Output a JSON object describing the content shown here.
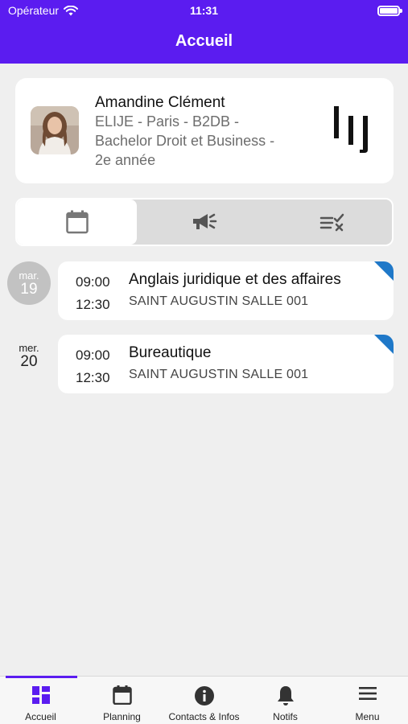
{
  "status_bar": {
    "carrier": "Opérateur",
    "time": "11:31"
  },
  "nav": {
    "title": "Accueil"
  },
  "profile": {
    "name": "Amandine Clément",
    "line1": "ELIJE - Paris - B2DB -",
    "line2": "Bachelor Droit et Business -",
    "line3": "2e année"
  },
  "segments": [
    {
      "icon": "calendar-icon",
      "active": true
    },
    {
      "icon": "megaphone-icon",
      "active": false
    },
    {
      "icon": "checklist-icon",
      "active": false
    }
  ],
  "days": [
    {
      "weekday": "mar.",
      "day": "19",
      "highlighted": true,
      "event": {
        "start": "09:00",
        "end": "12:30",
        "title": "Anglais juridique et des affaires",
        "room": "SAINT AUGUSTIN SALLE 001"
      }
    },
    {
      "weekday": "mer.",
      "day": "20",
      "highlighted": false,
      "event": {
        "start": "09:00",
        "end": "12:30",
        "title": "Bureautique",
        "room": "SAINT AUGUSTIN SALLE 001"
      }
    }
  ],
  "tabbar": {
    "items": [
      {
        "label": "Accueil",
        "icon": "dashboard-icon",
        "active": true
      },
      {
        "label": "Planning",
        "icon": "calendar-icon",
        "active": false
      },
      {
        "label": "Contacts & Infos",
        "icon": "info-icon",
        "active": false
      },
      {
        "label": "Notifs",
        "icon": "bell-icon",
        "active": false
      },
      {
        "label": "Menu",
        "icon": "hamburger-menu-icon",
        "active": false
      }
    ]
  },
  "colors": {
    "accent": "#5b1cf0",
    "corner_tag": "#1f78c8",
    "background": "#efefef"
  }
}
